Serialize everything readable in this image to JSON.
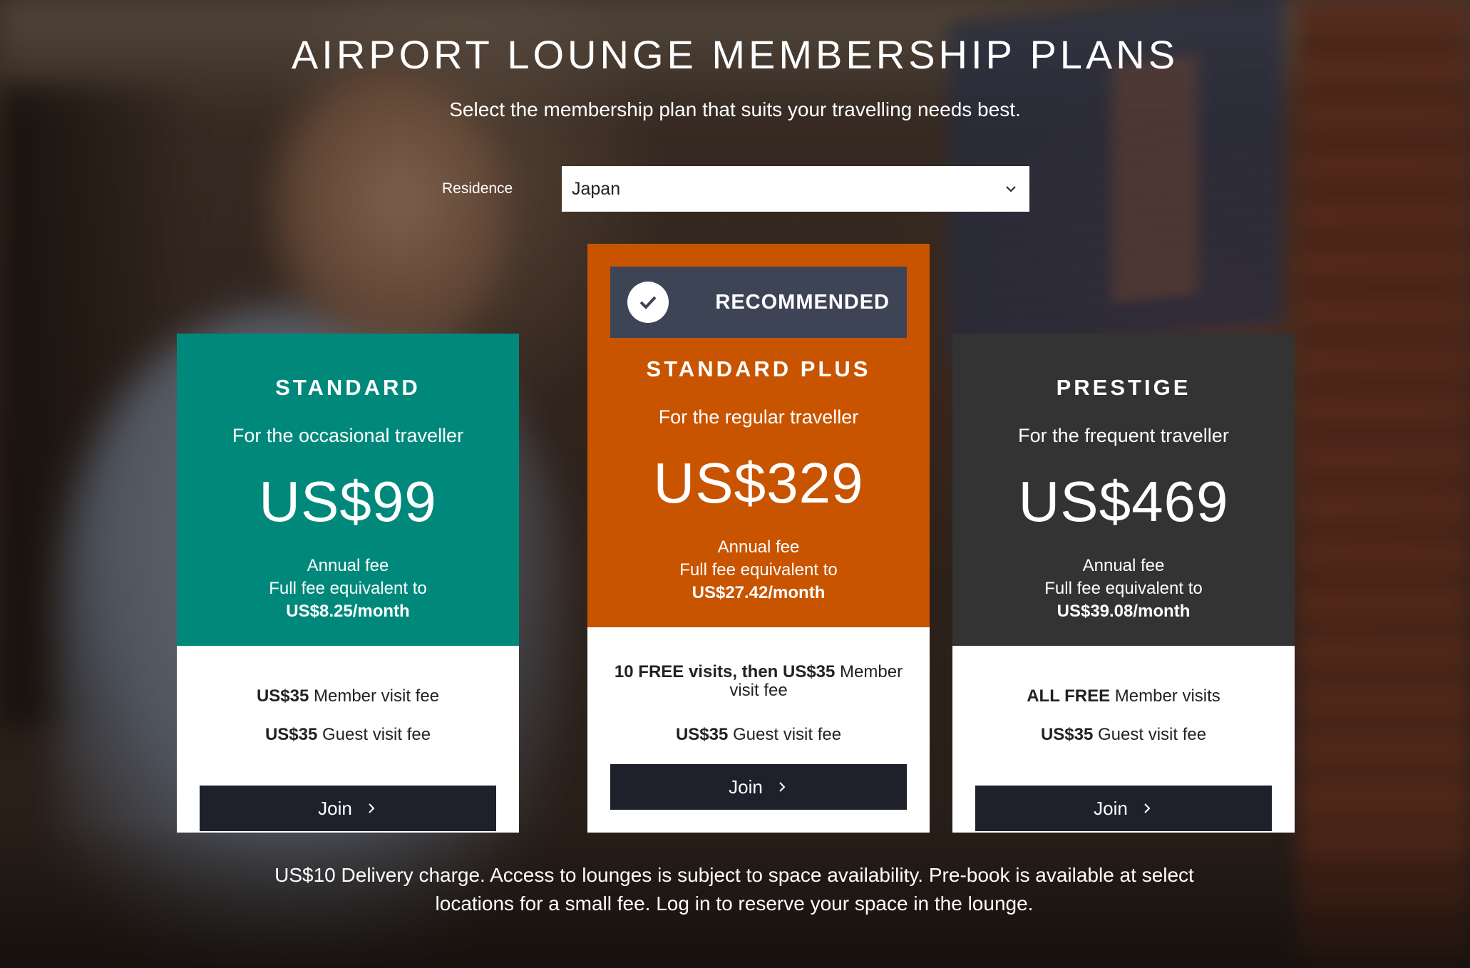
{
  "header": {
    "title": "AIRPORT LOUNGE MEMBERSHIP PLANS",
    "subtitle": "Select the membership plan that suits your travelling needs best."
  },
  "residence": {
    "label": "Residence",
    "selected": "Japan"
  },
  "plans": [
    {
      "name": "STANDARD",
      "tagline": "For the occasional traveller",
      "price": "US$99",
      "fee_label": "Annual fee",
      "equivalent_label": "Full fee equivalent to",
      "monthly": "US$8.25/month",
      "member_visit_bold": "US$35",
      "member_visit_text": " Member visit fee",
      "guest_visit_bold": "US$35",
      "guest_visit_text": " Guest visit fee",
      "join_label": "Join",
      "color": "#00897b"
    },
    {
      "name": "STANDARD PLUS",
      "badge": "RECOMMENDED",
      "tagline": "For the regular traveller",
      "price": "US$329",
      "fee_label": "Annual fee",
      "equivalent_label": "Full fee equivalent to",
      "monthly": "US$27.42/month",
      "member_visit_bold": "10 FREE visits, then US$35",
      "member_visit_text": " Member visit fee",
      "guest_visit_bold": "US$35",
      "guest_visit_text": " Guest visit fee",
      "join_label": "Join",
      "color": "#c85400"
    },
    {
      "name": "PRESTIGE",
      "tagline": "For the frequent traveller",
      "price": "US$469",
      "fee_label": "Annual fee",
      "equivalent_label": "Full fee equivalent to",
      "monthly": "US$39.08/month",
      "member_visit_bold": "ALL FREE",
      "member_visit_text": " Member visits",
      "guest_visit_bold": "US$35",
      "guest_visit_text": " Guest visit fee",
      "join_label": "Join",
      "color": "#333333"
    }
  ],
  "icons": {
    "residence_dropdown": "chevron-down-icon",
    "recommended": "check-circle-icon",
    "join": "chevron-right-icon"
  },
  "colors": {
    "recommended_banner": "#3d4455",
    "join_button": "#1e212b"
  },
  "footnote": "US$10 Delivery charge. Access to lounges is subject to space availability. Pre-book is available at select locations for a small fee. Log in to reserve your space in the lounge."
}
